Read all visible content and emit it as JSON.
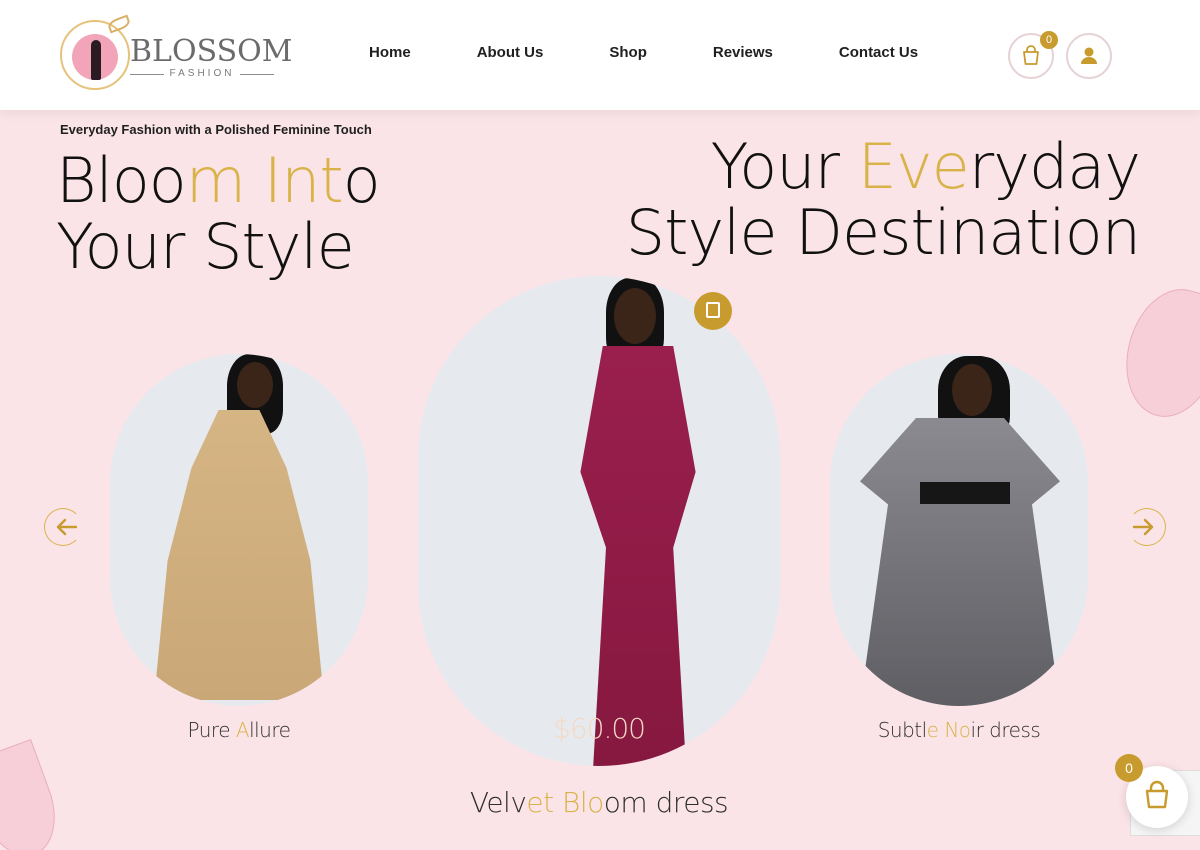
{
  "brand": {
    "name": "BLOSSOM",
    "sub": "FASHION"
  },
  "nav": {
    "items": [
      "Home",
      "About Us",
      "Shop",
      "Reviews",
      "Contact Us"
    ]
  },
  "header": {
    "cart_count": "0"
  },
  "hero": {
    "tagline": "Everyday Fashion with a Polished Feminine Touch",
    "left_a": "Bloo",
    "left_b": "m Int",
    "left_c": "o Your Style",
    "right_a": "Your ",
    "right_b": "Eve",
    "right_c": "ryday Style Destination"
  },
  "products": [
    {
      "title_a": "Pure ",
      "title_b": "A",
      "title_c": "llure"
    },
    {
      "title_a": "Velv",
      "title_b": "et Blo",
      "title_c": "om dress",
      "price": "$60.00"
    },
    {
      "title_a": "Subtl",
      "title_b": "e No",
      "title_c": "ir dress"
    }
  ],
  "floating_cart": {
    "count": "0"
  },
  "colors": {
    "background": "#fbe4e8",
    "accent_gold": "#c89b2e",
    "burgundy_dress": "#8e1b45",
    "tan_dress": "#d8b98a",
    "silver_dress": "#6d6d72"
  },
  "icons": {
    "cart": "shopping-bag-icon",
    "user": "user-icon",
    "prev": "arrow-left-icon",
    "next": "arrow-right-icon"
  }
}
